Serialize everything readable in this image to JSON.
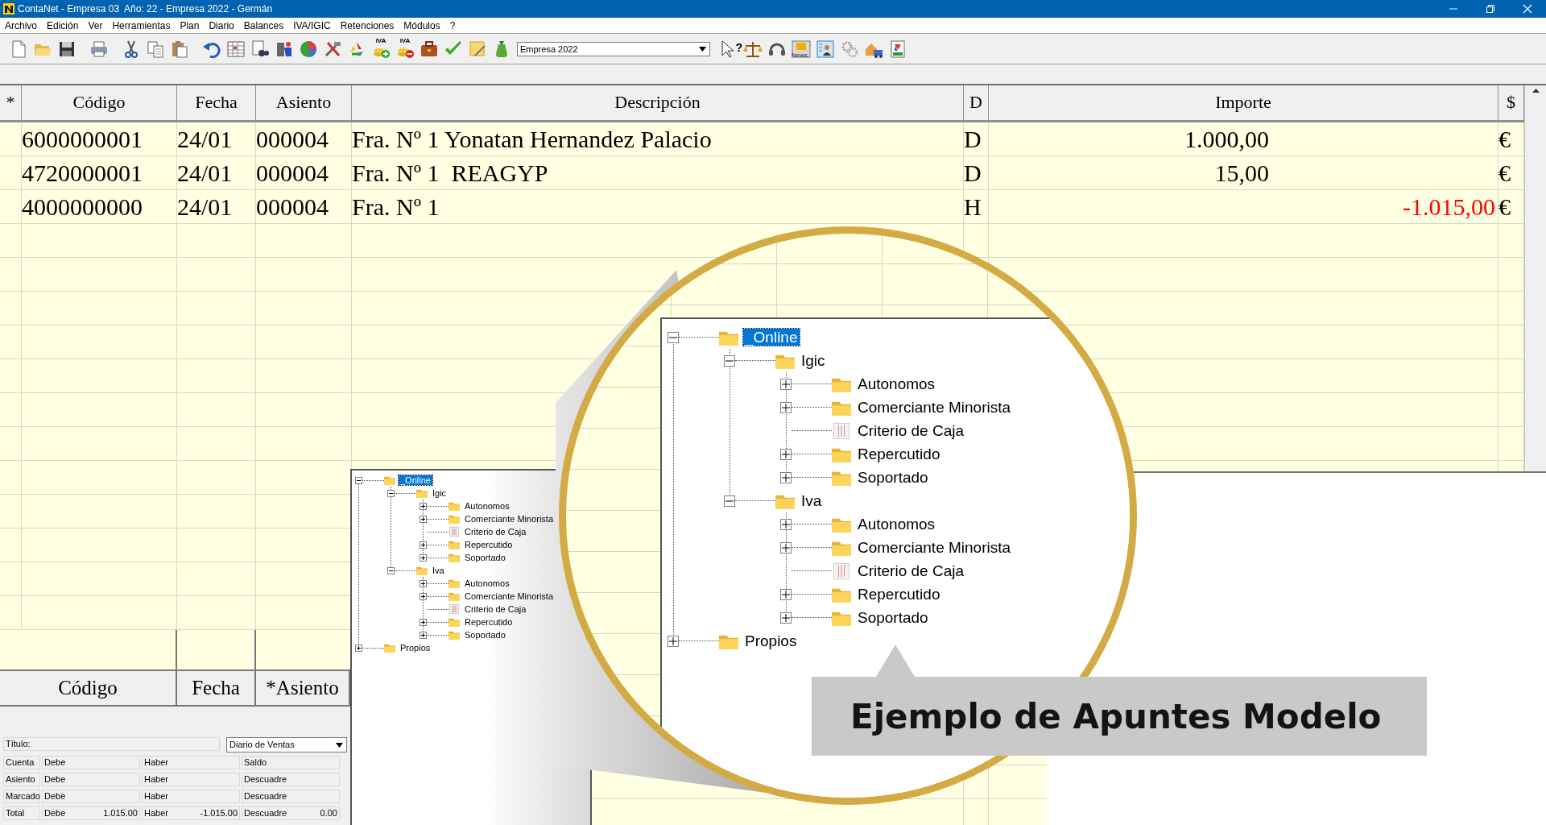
{
  "window": {
    "title": "ContaNet - Empresa 03  Año: 22 - Empresa 2022 - Germán"
  },
  "menu": [
    "Archivo",
    "Edición",
    "Ver",
    "Herramientas",
    "Plan",
    "Diario",
    "Balances",
    "IVA/IGIC",
    "Retenciones",
    "Módulos",
    "?"
  ],
  "toolbar": {
    "iva_add_badge": "IVA",
    "iva_remove_badge": "IVA",
    "company_select": {
      "value": "Empresa 2022"
    },
    "help_badge": "?",
    "news_badge": "News"
  },
  "journal_grid": {
    "columns": [
      "*",
      "Código",
      "Fecha",
      "Asiento",
      "Descripción",
      "D",
      "Importe",
      "$"
    ],
    "rows": [
      {
        "code": "6000000001",
        "date": "24/01",
        "entry": "000004",
        "description": "Fra. Nº 1 Yonatan Hernandez Palacio",
        "side": "D",
        "kind": "debit",
        "amount": "1.000,00",
        "currency": "€"
      },
      {
        "code": "4720000001",
        "date": "24/01",
        "entry": "000004",
        "description": "Fra. Nº 1  REAGYP",
        "side": "D",
        "kind": "debit",
        "amount": "15,00",
        "currency": "€"
      },
      {
        "code": "4000000000",
        "date": "24/01",
        "entry": "000004",
        "description": "Fra. Nº 1",
        "side": "H",
        "kind": "credit",
        "amount": "-1.015,00",
        "currency": "€"
      }
    ]
  },
  "search_grid": {
    "columns": [
      "Código",
      "Fecha",
      "*Asiento"
    ]
  },
  "summary": {
    "title_label": "Título:",
    "journal_select": {
      "value": "Diario de Ventas"
    },
    "rows": [
      {
        "label": "Cuenta",
        "cells": [
          {
            "label": "Debe"
          },
          {
            "label": "Haber"
          },
          {
            "label": "Saldo"
          }
        ]
      },
      {
        "label": "Asiento",
        "cells": [
          {
            "label": "Debe"
          },
          {
            "label": "Haber"
          },
          {
            "label": "Descuadre"
          }
        ]
      },
      {
        "label": "Marcado",
        "cells": [
          {
            "label": "Debe"
          },
          {
            "label": "Haber"
          },
          {
            "label": "Descuadre"
          }
        ]
      },
      {
        "label": "Total",
        "cells": [
          {
            "label": "Debe",
            "value": "1.015.00"
          },
          {
            "label": "Haber",
            "value": "-1.015.00"
          },
          {
            "label": "Descuadre",
            "value": "0.00"
          }
        ]
      }
    ]
  },
  "model_tree": {
    "items": [
      {
        "label": "_Online",
        "kind": "folder",
        "expanded": true,
        "selected": true,
        "children": [
          {
            "label": "Igic",
            "kind": "folder",
            "expanded": true,
            "selected": false,
            "children": [
              {
                "label": "Autonomos",
                "kind": "folder",
                "expanded": false,
                "selected": false
              },
              {
                "label": "Comerciante Minorista",
                "kind": "folder",
                "expanded": false,
                "selected": false
              },
              {
                "label": "Criterio de Caja",
                "kind": "table",
                "expanded": false,
                "selected": false
              },
              {
                "label": "Repercutido",
                "kind": "folder",
                "expanded": false,
                "selected": false
              },
              {
                "label": "Soportado",
                "kind": "folder",
                "expanded": false,
                "selected": false
              }
            ]
          },
          {
            "label": "Iva",
            "kind": "folder",
            "expanded": true,
            "selected": false,
            "children": [
              {
                "label": "Autonomos",
                "kind": "folder",
                "expanded": false,
                "selected": false
              },
              {
                "label": "Comerciante Minorista",
                "kind": "folder",
                "expanded": false,
                "selected": false
              },
              {
                "label": "Criterio de Caja",
                "kind": "table",
                "expanded": false,
                "selected": false
              },
              {
                "label": "Repercutido",
                "kind": "folder",
                "expanded": false,
                "selected": false
              },
              {
                "label": "Soportado",
                "kind": "folder",
                "expanded": false,
                "selected": false
              }
            ]
          }
        ]
      },
      {
        "label": "Propios",
        "kind": "folder",
        "expanded": false,
        "selected": false
      }
    ]
  },
  "magnifier": {
    "tree": {
      "items": [
        {
          "label": "_Online",
          "kind": "folder",
          "expanded": true,
          "selected": true,
          "children": [
            {
              "label": "Igic",
              "kind": "folder",
              "expanded": true,
              "selected": false,
              "children": [
                {
                  "label": "Autonomos",
                  "kind": "folder",
                  "expanded": false,
                  "selected": false
                },
                {
                  "label": "Comerciante Minorista",
                  "kind": "folder",
                  "expanded": false,
                  "selected": false
                },
                {
                  "label": "Criterio de Caja",
                  "kind": "table",
                  "expanded": false,
                  "selected": false
                },
                {
                  "label": "Repercutido",
                  "kind": "folder",
                  "expanded": false,
                  "selected": false
                },
                {
                  "label": "Soportado",
                  "kind": "folder",
                  "expanded": false,
                  "selected": false
                }
              ]
            },
            {
              "label": "Iva",
              "kind": "folder",
              "expanded": true,
              "selected": false,
              "children": [
                {
                  "label": "Autonomos",
                  "kind": "folder",
                  "expanded": false,
                  "selected": false
                },
                {
                  "label": "Comerciante Minorista",
                  "kind": "folder",
                  "expanded": false,
                  "selected": false
                },
                {
                  "label": "Criterio de Caja",
                  "kind": "table",
                  "expanded": false,
                  "selected": false
                },
                {
                  "label": "Repercutido",
                  "kind": "folder",
                  "expanded": false,
                  "selected": false
                },
                {
                  "label": "Soportado",
                  "kind": "folder",
                  "expanded": false,
                  "selected": false
                }
              ]
            }
          ]
        },
        {
          "label": "Propios",
          "kind": "folder",
          "expanded": false,
          "selected": false
        }
      ]
    },
    "caption": "Ejemplo de Apuntes Modelo"
  }
}
